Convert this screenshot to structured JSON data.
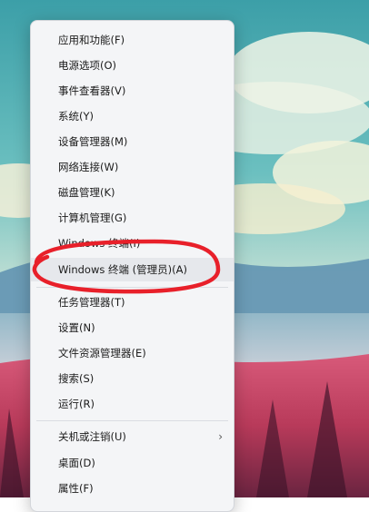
{
  "context_menu": {
    "items": [
      {
        "label": "应用和功能(F)"
      },
      {
        "label": "电源选项(O)"
      },
      {
        "label": "事件查看器(V)"
      },
      {
        "label": "系统(Y)"
      },
      {
        "label": "设备管理器(M)"
      },
      {
        "label": "网络连接(W)"
      },
      {
        "label": "磁盘管理(K)"
      },
      {
        "label": "计算机管理(G)"
      },
      {
        "label": "Windows 终端(I)"
      },
      {
        "label": "Windows 终端 (管理员)(A)"
      },
      {
        "label": "任务管理器(T)"
      },
      {
        "label": "设置(N)"
      },
      {
        "label": "文件资源管理器(E)"
      },
      {
        "label": "搜索(S)"
      },
      {
        "label": "运行(R)"
      },
      {
        "label": "关机或注销(U)"
      },
      {
        "label": "桌面(D)"
      },
      {
        "label": "属性(F)"
      }
    ],
    "submenu_arrow_icon": "chevron-right-icon"
  },
  "annotation_color": "#e8202a"
}
